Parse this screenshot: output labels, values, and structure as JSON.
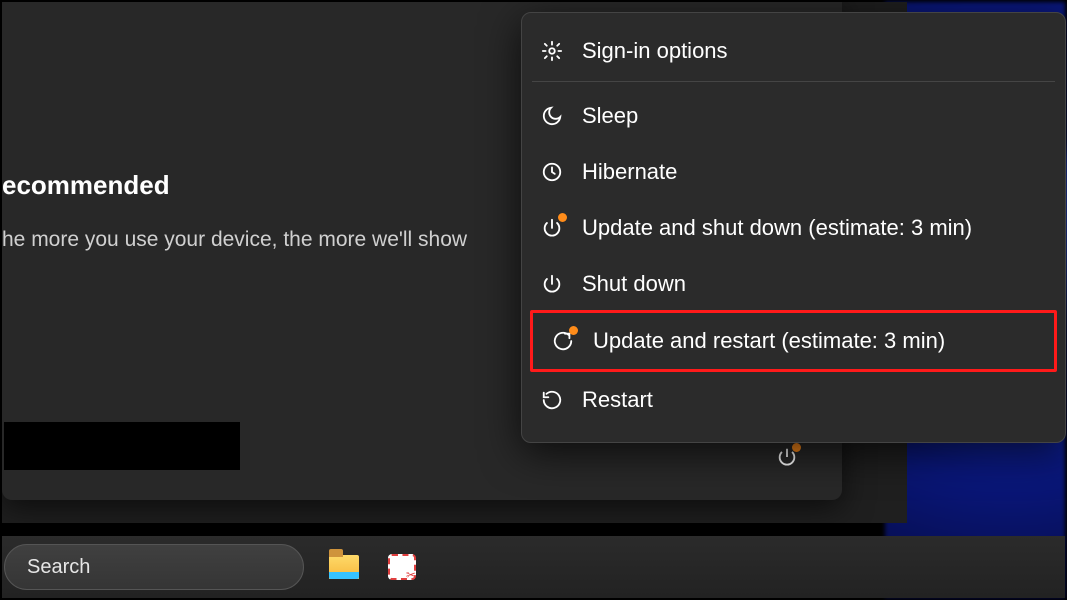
{
  "background": {
    "recommended_title": "ecommended",
    "recommended_sub": "he more you use your device, the more we'll show"
  },
  "power_menu": {
    "items": [
      {
        "id": "signin",
        "label": "Sign-in options",
        "icon": "gear-icon",
        "update_badge": false,
        "highlighted": false,
        "separator_after": true
      },
      {
        "id": "sleep",
        "label": "Sleep",
        "icon": "moon-icon",
        "update_badge": false,
        "highlighted": false,
        "separator_after": false
      },
      {
        "id": "hibernate",
        "label": "Hibernate",
        "icon": "clock-icon",
        "update_badge": false,
        "highlighted": false,
        "separator_after": false
      },
      {
        "id": "upd-shut",
        "label": "Update and shut down (estimate: 3 min)",
        "icon": "power-icon",
        "update_badge": true,
        "highlighted": false,
        "separator_after": false
      },
      {
        "id": "shut",
        "label": "Shut down",
        "icon": "power-icon",
        "update_badge": false,
        "highlighted": false,
        "separator_after": false
      },
      {
        "id": "upd-rest",
        "label": "Update and restart (estimate: 3 min)",
        "icon": "restart-arrow-icon",
        "update_badge": true,
        "highlighted": true,
        "separator_after": false
      },
      {
        "id": "restart",
        "label": "Restart",
        "icon": "restart-icon",
        "update_badge": false,
        "highlighted": false,
        "separator_after": false
      }
    ]
  },
  "power_tray": {
    "update_badge": true
  },
  "taskbar": {
    "search_placeholder": "Search"
  }
}
